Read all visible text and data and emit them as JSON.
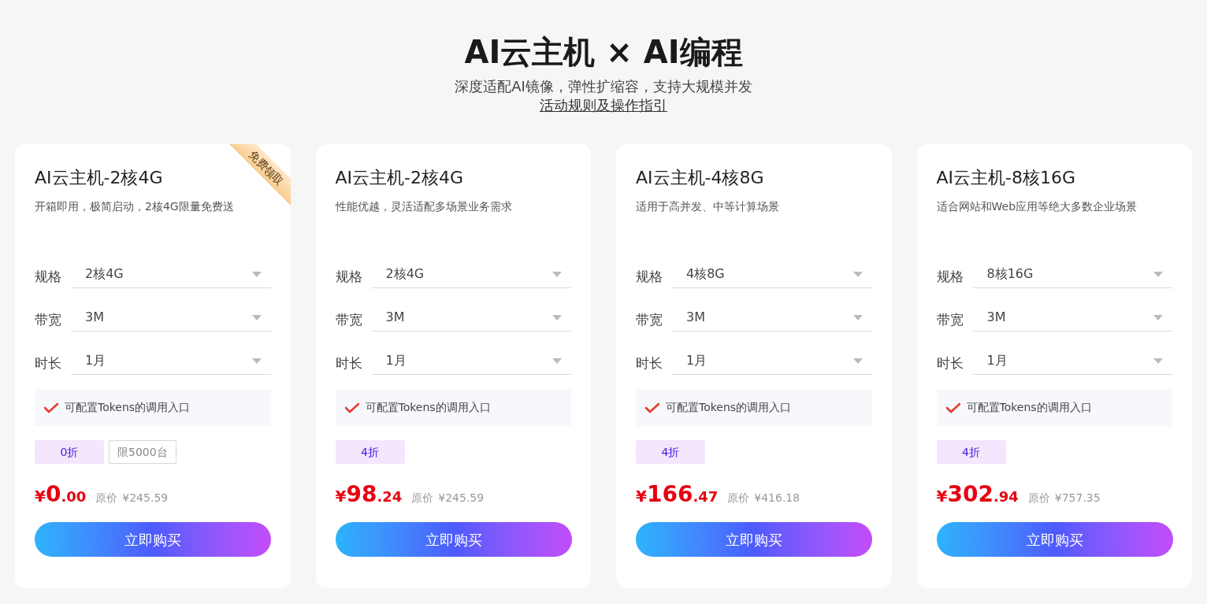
{
  "header": {
    "title": "AI云主机 × AI编程",
    "subtitle": "深度适配AI镜像，弹性扩缩容，支持大规模并发",
    "link": "活动规则及操作指引"
  },
  "cards": [
    {
      "title": "AI云主机-2核4G",
      "ribbon": "免费领取",
      "description": "开箱即用，极简启动，2核4G限量免费送",
      "options": [
        {
          "label": "规格",
          "value": "2核4G"
        },
        {
          "label": "带宽",
          "value": "3M"
        },
        {
          "label": "时长",
          "value": "1月"
        }
      ],
      "feature": "可配置Tokens的调用入口",
      "discount": "0折",
      "limit": "限5000台",
      "price": {
        "currency": "¥",
        "integer": "0",
        "decimal": ".00"
      },
      "original_label": "原价",
      "original_price": "¥245.59",
      "button": "立即购买"
    },
    {
      "title": "AI云主机-2核4G",
      "description": "性能优越，灵活适配多场景业务需求",
      "options": [
        {
          "label": "规格",
          "value": "2核4G"
        },
        {
          "label": "带宽",
          "value": "3M"
        },
        {
          "label": "时长",
          "value": "1月"
        }
      ],
      "feature": "可配置Tokens的调用入口",
      "discount": "4折",
      "price": {
        "currency": "¥",
        "integer": "98",
        "decimal": ".24"
      },
      "original_label": "原价",
      "original_price": "¥245.59",
      "button": "立即购买"
    },
    {
      "title": "AI云主机-4核8G",
      "description": "适用于高并发、中等计算场景",
      "options": [
        {
          "label": "规格",
          "value": "4核8G"
        },
        {
          "label": "带宽",
          "value": "3M"
        },
        {
          "label": "时长",
          "value": "1月"
        }
      ],
      "feature": "可配置Tokens的调用入口",
      "discount": "4折",
      "price": {
        "currency": "¥",
        "integer": "166",
        "decimal": ".47"
      },
      "original_label": "原价",
      "original_price": "¥416.18",
      "button": "立即购买"
    },
    {
      "title": "AI云主机-8核16G",
      "description": "适合网站和Web应用等绝大多数企业场景",
      "options": [
        {
          "label": "规格",
          "value": "8核16G"
        },
        {
          "label": "带宽",
          "value": "3M"
        },
        {
          "label": "时长",
          "value": "1月"
        }
      ],
      "feature": "可配置Tokens的调用入口",
      "discount": "4折",
      "price": {
        "currency": "¥",
        "integer": "302",
        "decimal": ".94"
      },
      "original_label": "原价",
      "original_price": "¥757.35",
      "button": "立即购买"
    }
  ]
}
